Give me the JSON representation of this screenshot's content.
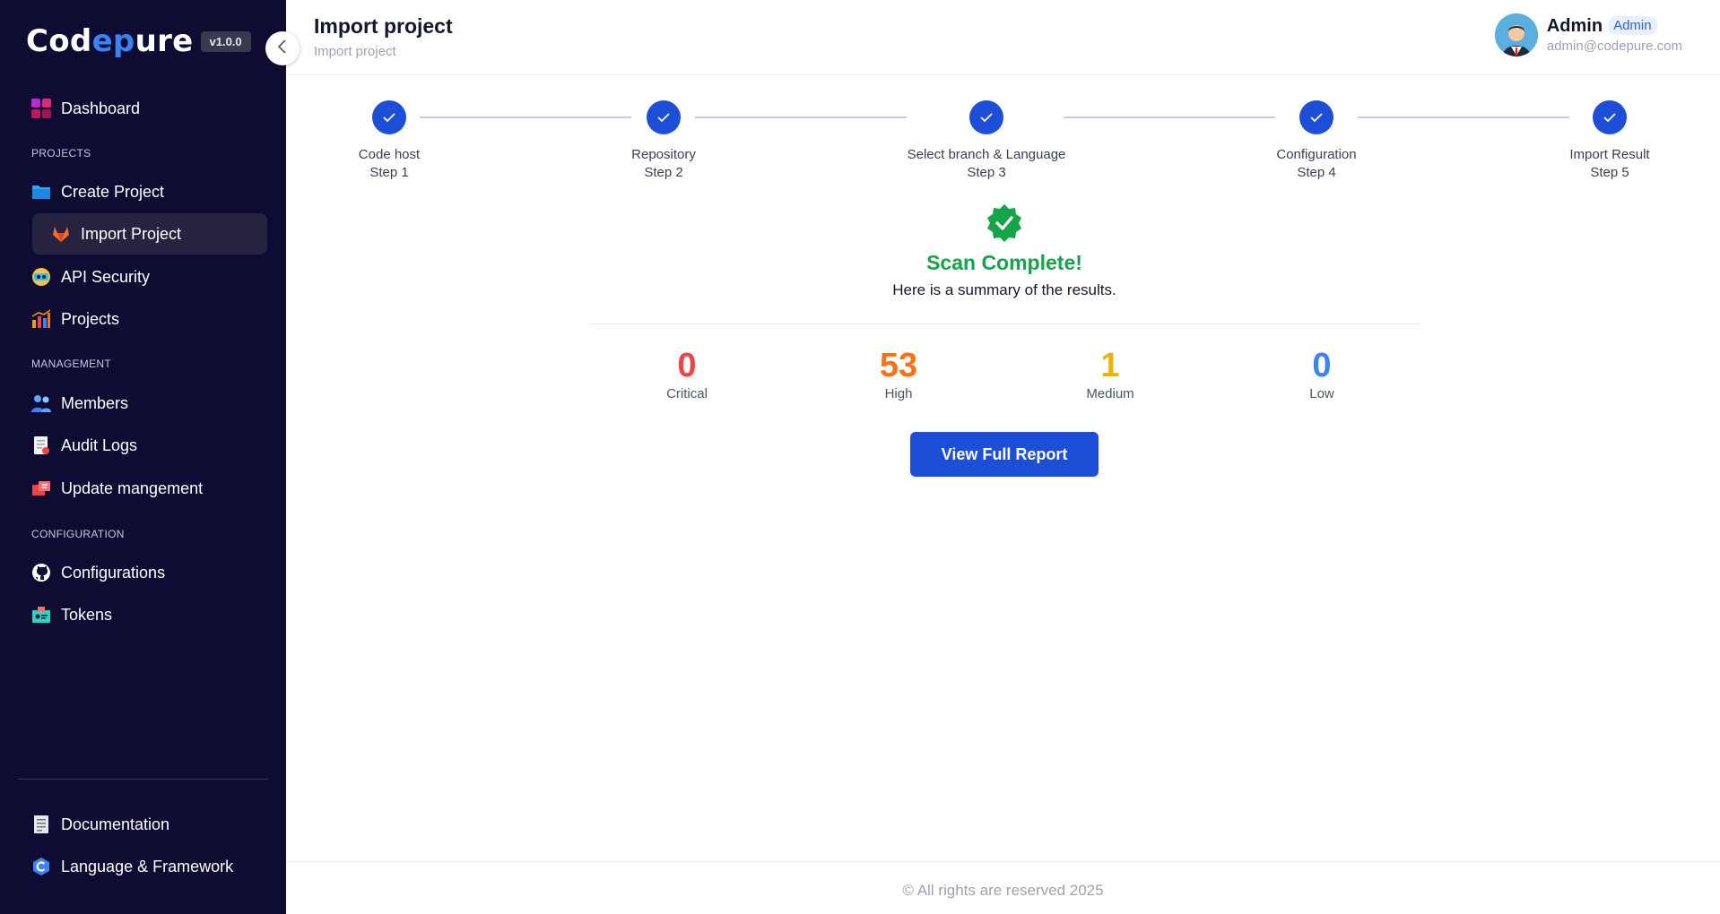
{
  "sidebar": {
    "logo_part1": "Cod",
    "logo_part2": "ep",
    "logo_part3": "ure",
    "version": "v1.0.0",
    "dashboard": "Dashboard",
    "section_projects": "PROJECTS",
    "create_project": "Create Project",
    "import_project": "Import Project",
    "api_security": "API Security",
    "projects": "Projects",
    "section_management": "MANAGEMENT",
    "members": "Members",
    "audit_logs": "Audit Logs",
    "update_management": "Update mangement",
    "section_configuration": "CONFIGURATION",
    "configurations": "Configurations",
    "tokens": "Tokens",
    "documentation": "Documentation",
    "language_framework": "Language & Framework"
  },
  "header": {
    "title": "Import project",
    "breadcrumb": "Import project",
    "user_name": "Admin",
    "user_role": "Admin",
    "user_email": "admin@codepure.com"
  },
  "stepper": {
    "steps": [
      {
        "label": "Code host",
        "step": "Step 1"
      },
      {
        "label": "Repository",
        "step": "Step 2"
      },
      {
        "label": "Select branch & Language",
        "step": "Step 3"
      },
      {
        "label": "Configuration",
        "step": "Step 4"
      },
      {
        "label": "Import Result",
        "step": "Step 5"
      }
    ]
  },
  "result": {
    "title": "Scan Complete!",
    "subtitle": "Here is a summary of the results.",
    "metrics": [
      {
        "value": "0",
        "label": "Critical",
        "color": "#ef4444"
      },
      {
        "value": "53",
        "label": "High",
        "color": "#f97316"
      },
      {
        "value": "1",
        "label": "Medium",
        "color": "#eab308"
      },
      {
        "value": "0",
        "label": "Low",
        "color": "#3b82f6"
      }
    ],
    "button": "View Full Report"
  },
  "footer": {
    "text": "© All rights are reserved 2025"
  },
  "colors": {
    "sidebar_bg": "#0f0c33",
    "primary": "#1d4ed8",
    "success": "#16a34a"
  }
}
